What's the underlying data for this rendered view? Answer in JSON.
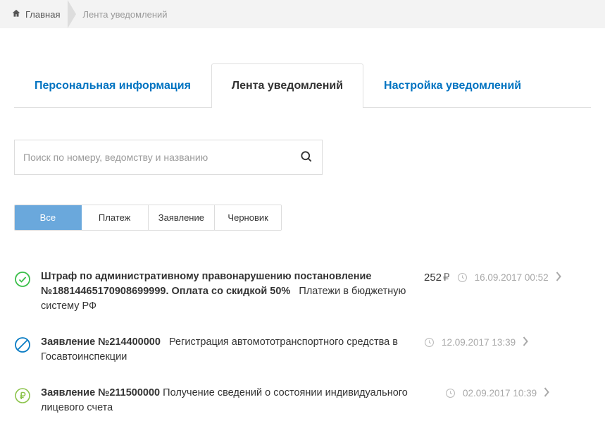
{
  "breadcrumb": {
    "home": "Главная",
    "current": "Лента уведомлений"
  },
  "tabs": {
    "personal": "Персональная информация",
    "feed": "Лента уведомлений",
    "settings": "Настройка уведомлений"
  },
  "search": {
    "placeholder": "Поиск по номеру, ведомству и названию"
  },
  "filters": {
    "all": "Все",
    "payment": "Платеж",
    "application": "Заявление",
    "draft": "Черновик"
  },
  "items": [
    {
      "title": "Штраф по административному правонарушению постановление №18814465170908699999. Оплата со скидкой 50%",
      "desc": "Платежи в бюджетную систему РФ",
      "amount": "252",
      "date": "16.09.2017 00:52"
    },
    {
      "title": "Заявление №214400000",
      "desc": "Регистрация автомототранспортного средства в Госавтоинспекции",
      "date": "12.09.2017 13:39"
    },
    {
      "title": "Заявление №211500000",
      "desc": "Получение сведений о состоянии индивидуального лицевого счета",
      "date": "02.09.2017 10:39"
    }
  ]
}
